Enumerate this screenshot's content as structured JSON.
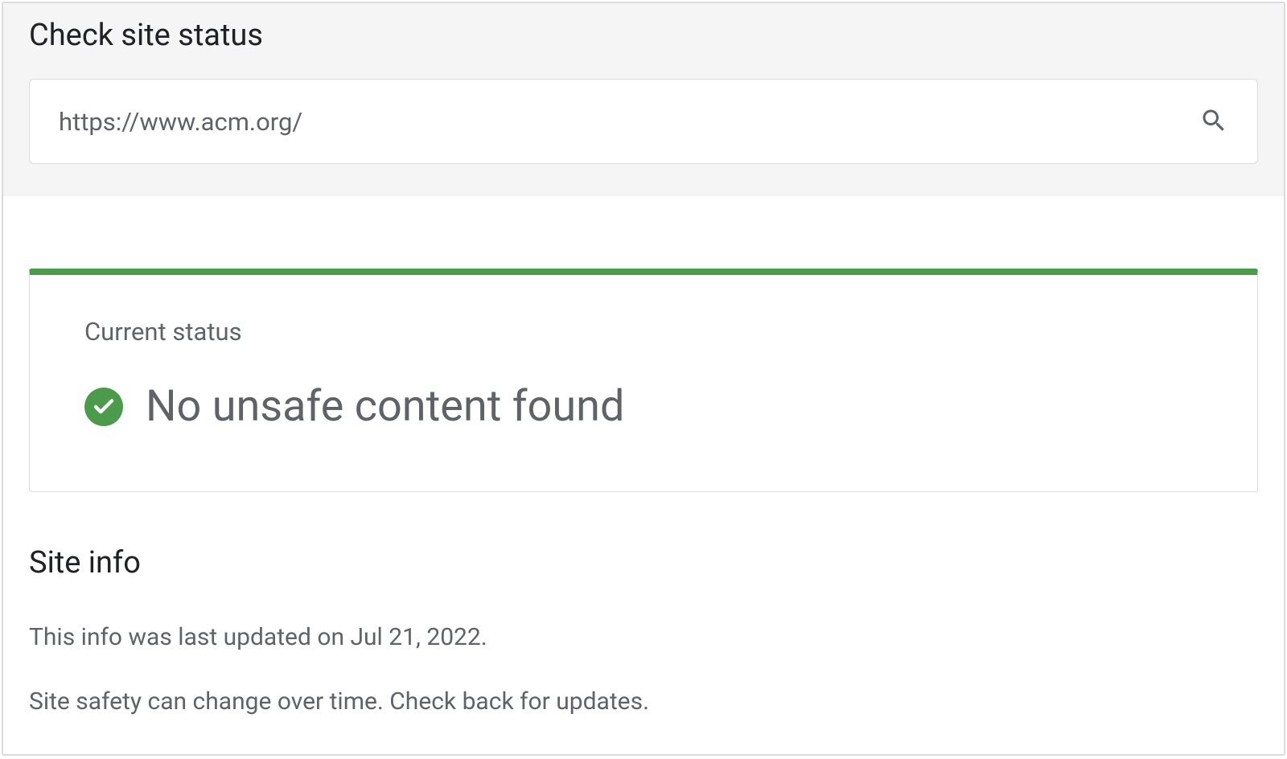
{
  "header": {
    "title": "Check site status"
  },
  "search": {
    "value": "https://www.acm.org/"
  },
  "status": {
    "label": "Current status",
    "message": "No unsafe content found",
    "accent_color": "#4c9a4c"
  },
  "site_info": {
    "title": "Site info",
    "updated_text": "This info was last updated on Jul 21, 2022.",
    "disclaimer": "Site safety can change over time. Check back for updates."
  }
}
